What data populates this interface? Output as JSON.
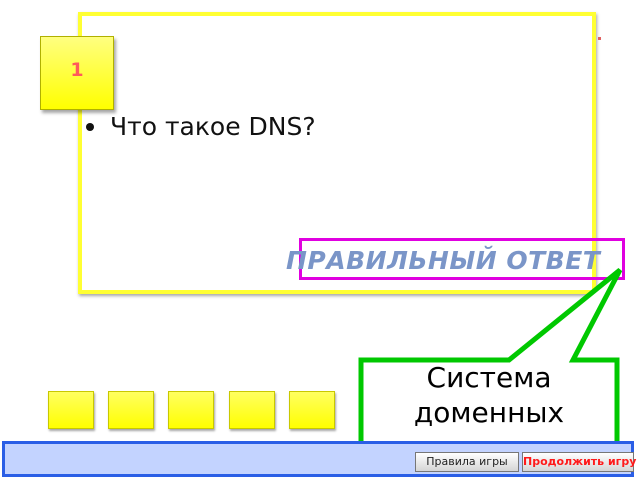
{
  "question_number": "1",
  "question": {
    "text": "Что такое DNS?"
  },
  "answer_button": {
    "label": "ПРАВИЛЬНЫЙ ОТВЕТ"
  },
  "answer_callout": {
    "text": "Система доменных"
  },
  "footer": {
    "rules_label": "Правила игры",
    "continue_label": "Продолжить игру"
  },
  "colors": {
    "tile_yellow": "#ffff00",
    "card_border": "#ffff33",
    "answer_border": "#e000e0",
    "answer_text": "#7a95c8",
    "callout_border": "#00c800",
    "bar_fill": "#c3d3ff",
    "bar_border": "#2a5ee6",
    "continue_text": "#ff1a1a"
  }
}
